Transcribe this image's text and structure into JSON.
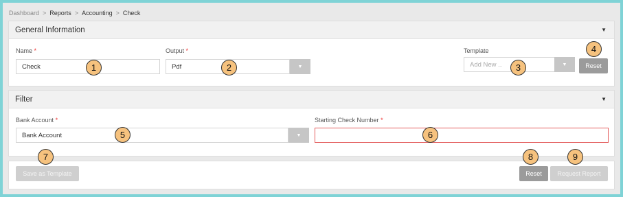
{
  "breadcrumb": [
    "Dashboard",
    "Reports",
    "Accounting",
    "Check"
  ],
  "general": {
    "title": "General Information",
    "name_label": "Name",
    "name_value": "Check",
    "output_label": "Output",
    "output_value": "Pdf",
    "template_label": "Template",
    "template_placeholder": "Add New ..",
    "reset_label": "Reset"
  },
  "filter": {
    "title": "Filter",
    "bank_label": "Bank Account",
    "bank_value": "Bank Account",
    "check_label": "Starting Check Number",
    "check_value": ""
  },
  "footer": {
    "save_template_label": "Save as Template",
    "reset_label": "Reset",
    "request_label": "Request Report"
  },
  "required_marker": "*",
  "breadcrumb_sep": ">",
  "markers": [
    "1",
    "2",
    "3",
    "4",
    "5",
    "6",
    "7",
    "8",
    "9"
  ]
}
